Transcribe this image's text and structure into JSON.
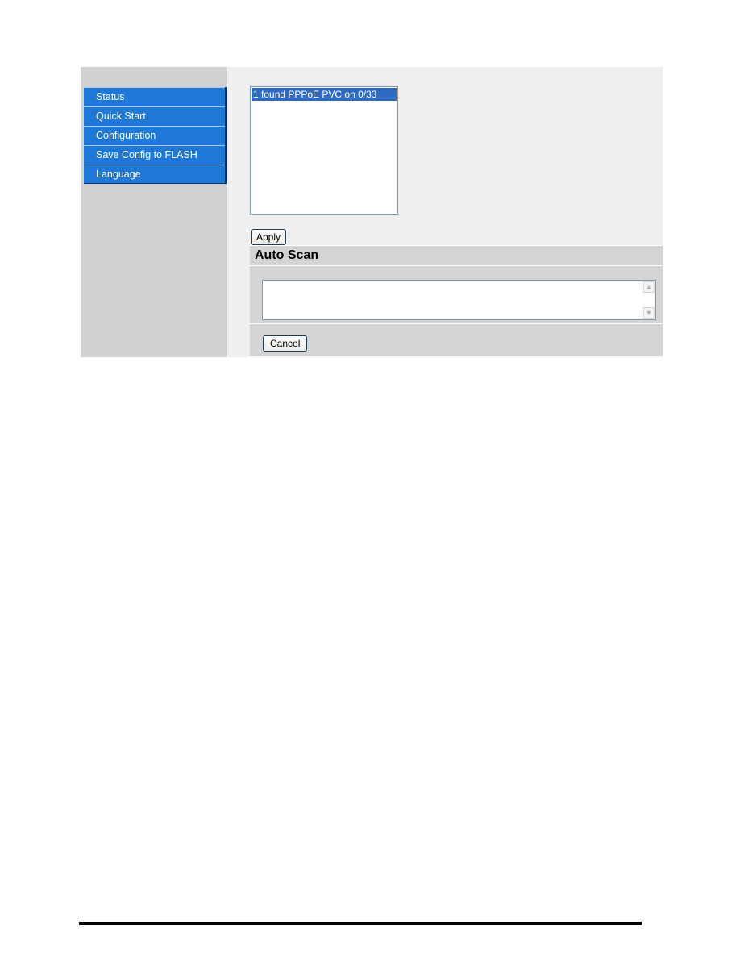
{
  "sidebar": {
    "items": [
      {
        "label": "Status"
      },
      {
        "label": "Quick Start"
      },
      {
        "label": "Configuration"
      },
      {
        "label": "Save Config to FLASH"
      },
      {
        "label": "Language"
      }
    ]
  },
  "main": {
    "pvc_list": {
      "options": [
        "1 found PPPoE PVC on 0/33"
      ],
      "selected": "1 found PPPoE PVC on 0/33"
    },
    "apply_label": "Apply",
    "auto_scan": {
      "title": "Auto Scan",
      "log_value": "",
      "scroll_up_icon": "▲",
      "scroll_down_icon": "▼",
      "cancel_label": "Cancel"
    }
  },
  "colors": {
    "menu_bg": "#1f78d8",
    "selection": "#316ac5",
    "sidebar_bg": "#d0d0d0",
    "content_bg": "#efeef0",
    "section_bg": "#d4d4d4"
  }
}
